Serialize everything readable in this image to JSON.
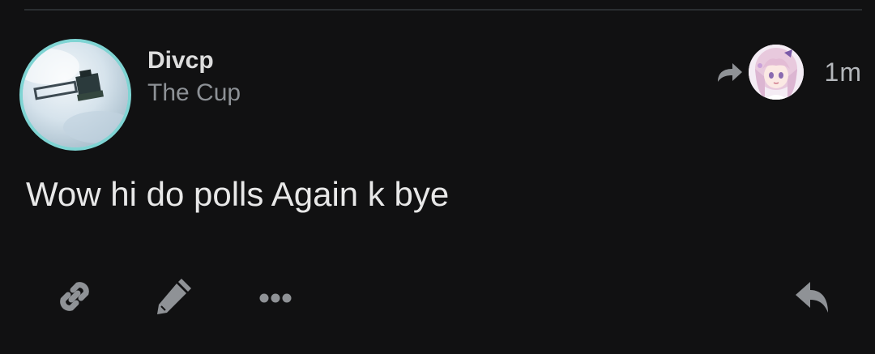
{
  "post": {
    "author": {
      "name": "Divcp",
      "community": "The Cup"
    },
    "time": "1m",
    "body": "Wow hi do polls Again k bye"
  },
  "icons": {
    "share": "share-arrow-icon",
    "link": "link-icon",
    "edit": "pencil-icon",
    "more": "more-dots-icon",
    "reply": "reply-icon"
  },
  "colors": {
    "background": "#111112",
    "avatar_ring": "#7fd4d3",
    "icon_gray": "#8f9296",
    "text_primary": "#e8e8e8",
    "text_secondary": "#8d9196"
  }
}
